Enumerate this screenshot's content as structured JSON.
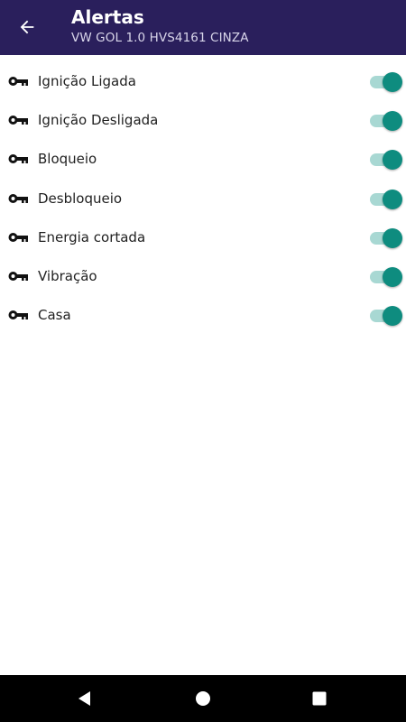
{
  "header": {
    "title": "Alertas",
    "subtitle": "VW GOL 1.0 HVS4161 CINZA",
    "back_icon": "arrow-left-icon",
    "background_color": "#2a1f5c"
  },
  "alerts": [
    {
      "label": "Ignição Ligada",
      "icon": "key-icon",
      "enabled": true
    },
    {
      "label": "Ignição Desligada",
      "icon": "key-icon",
      "enabled": true
    },
    {
      "label": "Bloqueio",
      "icon": "key-icon",
      "enabled": true
    },
    {
      "label": "Desbloqueio",
      "icon": "key-icon",
      "enabled": true
    },
    {
      "label": "Energia cortada",
      "icon": "key-icon",
      "enabled": true
    },
    {
      "label": "Vibração",
      "icon": "key-icon",
      "enabled": true
    },
    {
      "label": "Casa",
      "icon": "key-icon",
      "enabled": true
    }
  ],
  "colors": {
    "switch_thumb": "#0e8c7f",
    "switch_track": "#a8d8d3"
  },
  "system_nav": {
    "back_icon": "triangle-back-icon",
    "home_icon": "circle-home-icon",
    "recent_icon": "square-recents-icon"
  }
}
